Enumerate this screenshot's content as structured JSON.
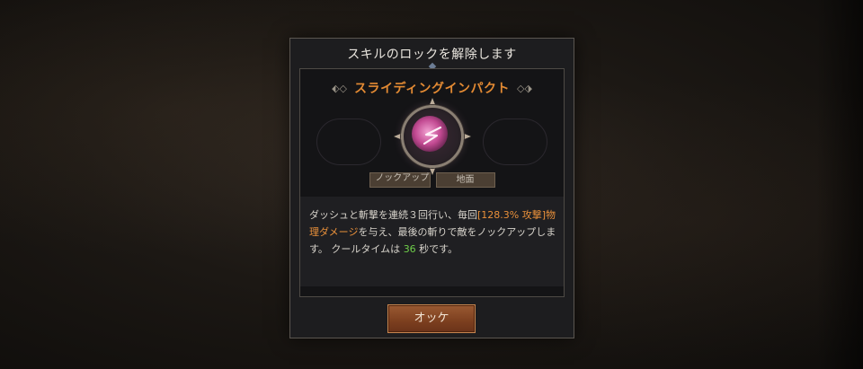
{
  "dialog": {
    "title": "スキルのロックを解除します"
  },
  "skill": {
    "name": "スライディングインパクト",
    "icon": "slash-icon",
    "tags": [
      "ノックアップ",
      "地面"
    ],
    "description": {
      "part1": "ダッシュと斬撃を連続３回行い、毎回",
      "highlight_damage": "[128.3% 攻撃]物理ダメージ",
      "part2": "を与え、最後の斬りで敵をノックアップします。 クールタイムは ",
      "cooldown": "36",
      "part3": " 秒です。"
    }
  },
  "button": {
    "ok_label": "オッケ"
  },
  "colors": {
    "accent_orange": "#e38a33",
    "highlight_green": "#6fcf4a",
    "button_brown": "#7c3f1f"
  }
}
